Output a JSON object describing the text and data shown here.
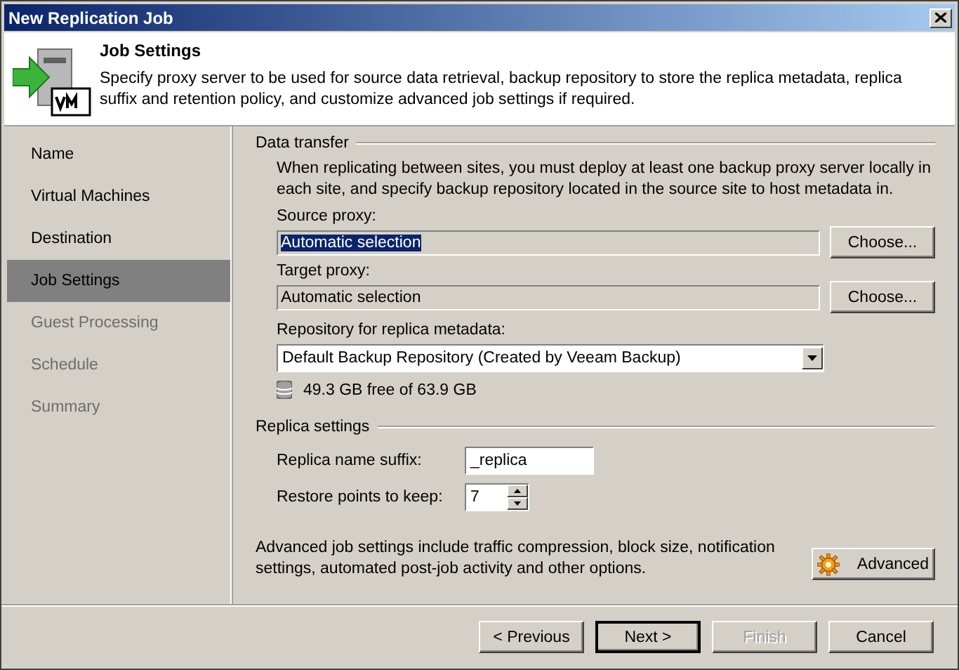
{
  "window": {
    "title": "New Replication Job"
  },
  "header": {
    "title": "Job Settings",
    "description": "Specify proxy server to be used for source data retrieval, backup repository to store the replica metadata, replica suffix and retention policy, and customize advanced job settings if required."
  },
  "sidebar": {
    "items": [
      {
        "label": "Name",
        "selected": false,
        "disabled": false
      },
      {
        "label": "Virtual Machines",
        "selected": false,
        "disabled": false
      },
      {
        "label": "Destination",
        "selected": false,
        "disabled": false
      },
      {
        "label": "Job Settings",
        "selected": true,
        "disabled": false
      },
      {
        "label": "Guest Processing",
        "selected": false,
        "disabled": true
      },
      {
        "label": "Schedule",
        "selected": false,
        "disabled": true
      },
      {
        "label": "Summary",
        "selected": false,
        "disabled": true
      }
    ]
  },
  "data_transfer": {
    "title": "Data transfer",
    "description": "When replicating between sites, you must deploy at least one backup proxy server locally in each site, and specify backup repository located in the source site to host metadata in.",
    "source_proxy": {
      "label": "Source proxy:",
      "value": "Automatic selection",
      "selected": true,
      "button": "Choose..."
    },
    "target_proxy": {
      "label": "Target proxy:",
      "value": "Automatic selection",
      "selected": false,
      "button": "Choose..."
    },
    "repository": {
      "label": "Repository for replica metadata:",
      "value": "Default Backup Repository (Created by Veeam Backup)",
      "space": "49.3 GB free of 63.9 GB"
    }
  },
  "replica_settings": {
    "title": "Replica settings",
    "suffix": {
      "label": "Replica name suffix:",
      "value": "_replica"
    },
    "restore_points": {
      "label": "Restore points to keep:",
      "value": "7"
    }
  },
  "advanced": {
    "text": "Advanced job settings include traffic compression, block size, notification settings, automated post-job activity and other options.",
    "button": "Advanced"
  },
  "buttons": [
    {
      "label": "< Previous",
      "disabled": false,
      "default": false
    },
    {
      "label": "Next >",
      "disabled": false,
      "default": true
    },
    {
      "label": "Finish",
      "disabled": true,
      "default": false
    },
    {
      "label": "Cancel",
      "disabled": false,
      "default": false
    }
  ]
}
